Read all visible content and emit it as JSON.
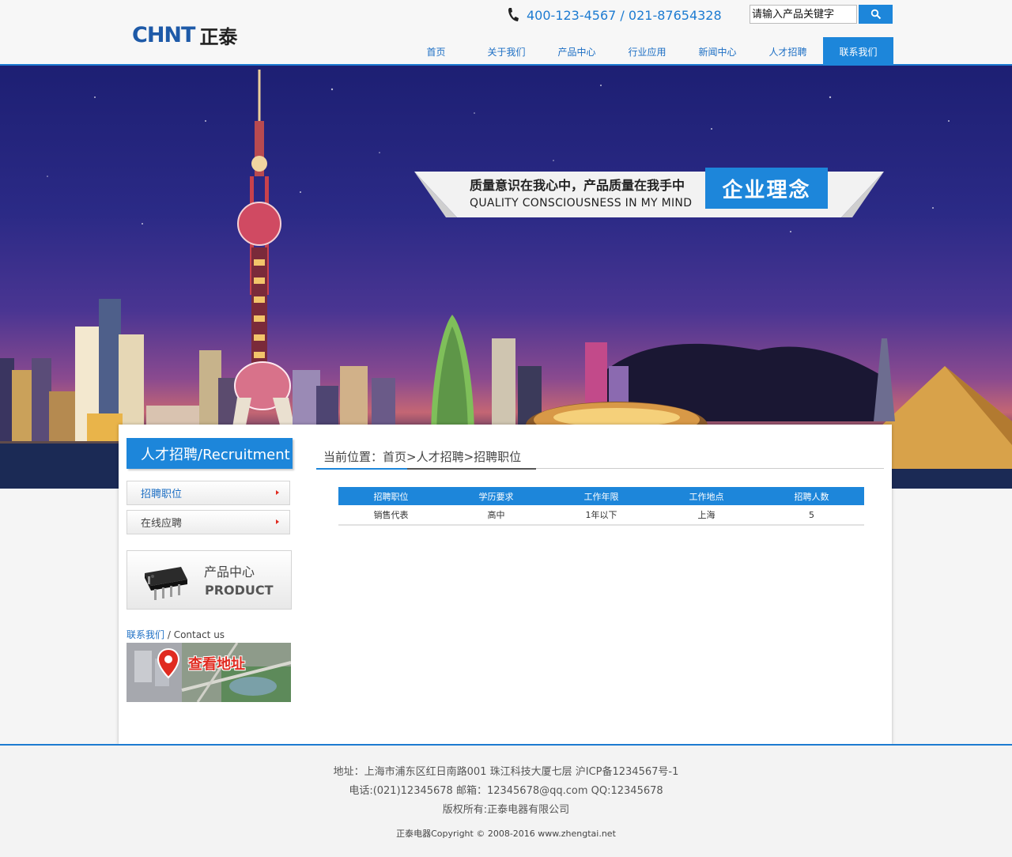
{
  "header": {
    "logo_latin_1": "CH",
    "logo_latin_2": "NT",
    "logo_cn": "正泰",
    "phone": "400-123-4567 / 021-87654328",
    "search_placeholder": "请输入产品关键字",
    "nav": [
      "首页",
      "关于我们",
      "产品中心",
      "行业应用",
      "新闻中心",
      "人才招聘",
      "联系我们"
    ],
    "active_nav": "联系我们"
  },
  "banner": {
    "slogan_cn": "质量意识在我心中，产品质量在我手中",
    "slogan_en": "QUALITY CONSCIOUSNESS IN MY MIND",
    "tag": "企业理念"
  },
  "sidebar": {
    "title": "人才招聘/Recruitment",
    "items": [
      "招聘职位",
      "在线应聘"
    ],
    "product_cn": "产品中心",
    "product_en": "PRODUCT",
    "contact_cn": "联系我们",
    "contact_en": " / Contact us",
    "map_label": "查看地址"
  },
  "main": {
    "breadcrumb": "当前位置：首页>人才招聘>招聘职位",
    "table": {
      "headers": [
        "招聘职位",
        "学历要求",
        "工作年限",
        "工作地点",
        "招聘人数"
      ],
      "rows": [
        [
          "销售代表",
          "高中",
          "1年以下",
          "上海",
          "5"
        ]
      ]
    }
  },
  "footer": {
    "address": "地址：上海市浦东区红日南路001 珠江科技大厦七层 沪ICP备1234567号-1",
    "contact": "电话:(021)12345678 邮箱：12345678@qq.com QQ:12345678",
    "rights": "版权所有:正泰电器有限公司",
    "copyright": "正泰电器Copyright © 2008-2016   www.zhengtai.net"
  },
  "colors": {
    "accent": "#1d86da",
    "brand": "#1e5aa8",
    "red": "#e02b20"
  }
}
